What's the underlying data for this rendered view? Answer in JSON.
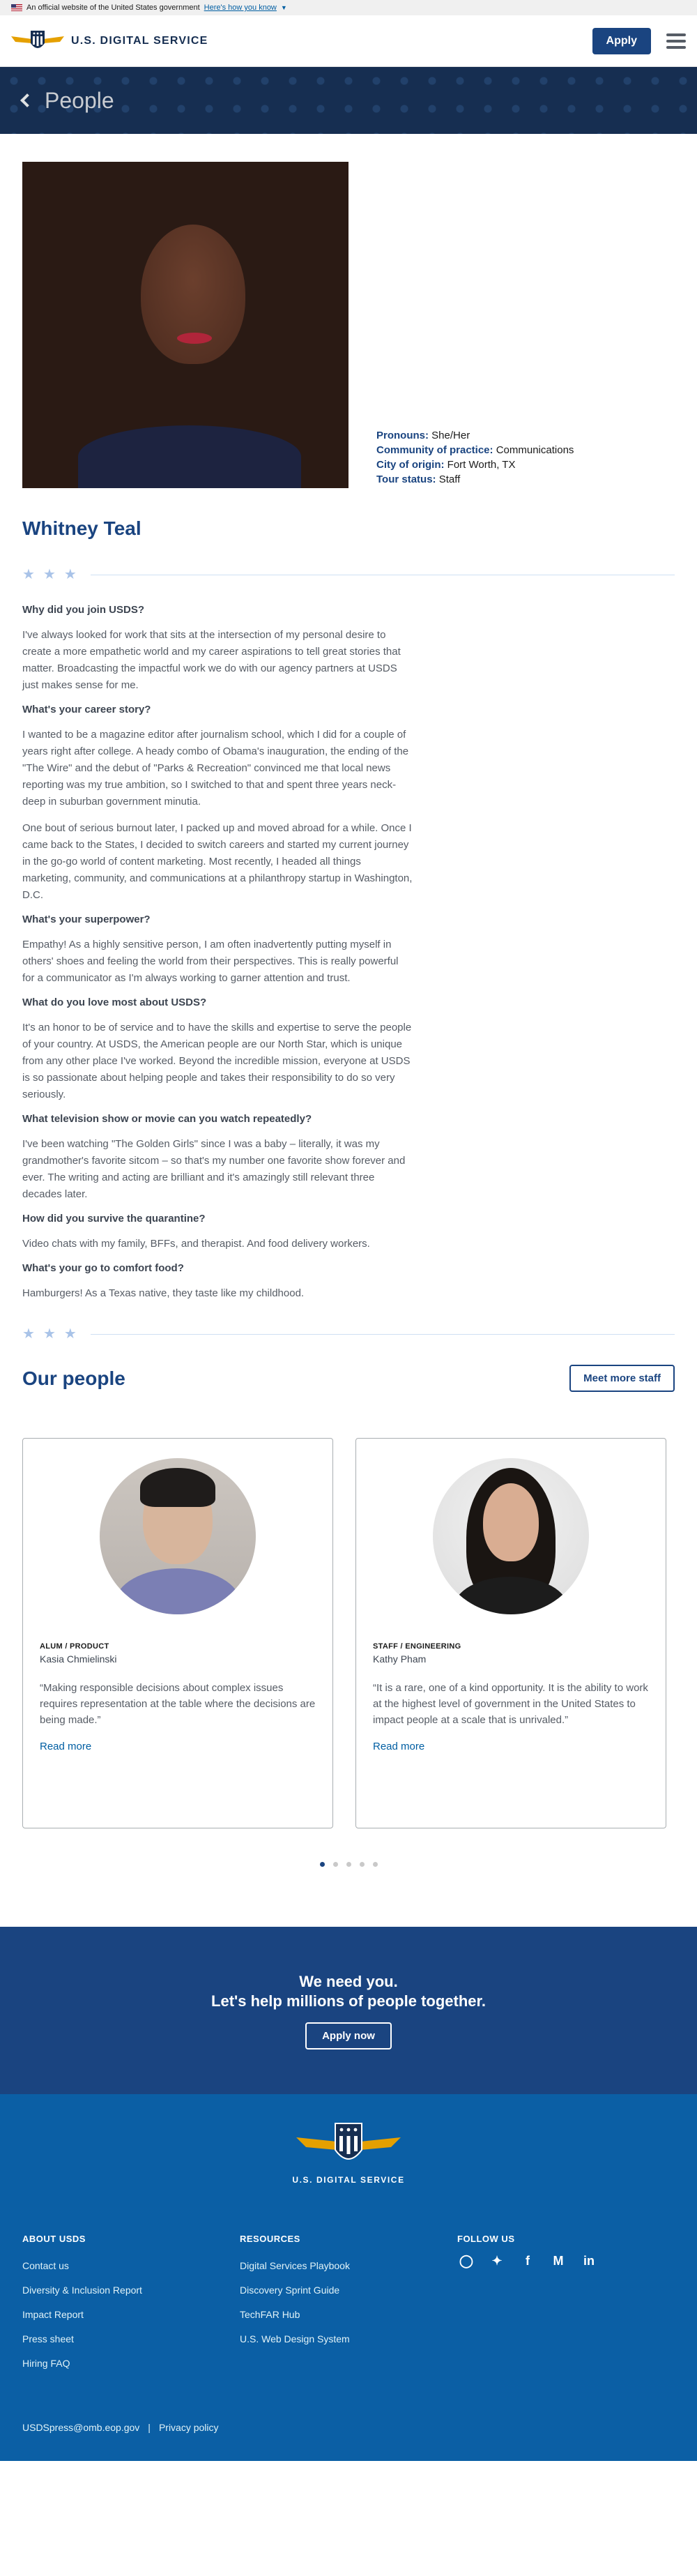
{
  "gov_banner": {
    "text": "An official website of the United States government",
    "link": "Here's how you know"
  },
  "header": {
    "logo_text": "U.S. DIGITAL SERVICE",
    "apply_label": "Apply"
  },
  "hero": {
    "title": "People"
  },
  "profile": {
    "facts": [
      {
        "label": "Pronouns:",
        "value": "She/Her"
      },
      {
        "label": "Community of practice:",
        "value": "Communications"
      },
      {
        "label": "City of origin:",
        "value": "Fort Worth, TX"
      },
      {
        "label": "Tour status:",
        "value": "Staff"
      }
    ],
    "name": "Whitney Teal",
    "qa": [
      {
        "q": "Why did you join USDS?",
        "a": [
          "I've always looked for work that sits at the intersection of my personal desire to create a more empathetic world and my career aspirations to tell great stories that matter. Broadcasting the impactful work we do with our agency partners at USDS just makes sense for me."
        ]
      },
      {
        "q": "What's your career story?",
        "a": [
          "I wanted to be a magazine editor after journalism school, which I did for a couple of years right after college. A heady combo of Obama's inauguration, the ending of the \"The Wire\" and the debut of \"Parks & Recreation\" convinced me that local news reporting was my true ambition, so I switched to that and spent three years neck-deep in suburban government minutia.",
          "One bout of serious burnout later, I packed up and moved abroad for a while. Once I came back to the States, I decided to switch careers and started my current journey in the go-go world of content marketing. Most recently, I headed all things marketing, community, and communications at a philanthropy startup in Washington, D.C."
        ]
      },
      {
        "q": "What's your superpower?",
        "a": [
          "Empathy! As a highly sensitive person, I am often inadvertently putting myself in others' shoes and feeling the world from their perspectives. This is really powerful for a communicator as I'm always working to garner attention and trust."
        ]
      },
      {
        "q": "What do you love most about USDS?",
        "a": [
          "It's an honor to be of service and to have the skills and expertise to serve the people of your country. At USDS, the American people are our North Star, which is unique from any other place I've worked. Beyond the incredible mission, everyone at USDS is so passionate about helping people and takes their responsibility to do so very seriously."
        ]
      },
      {
        "q": "What television show or movie can you watch repeatedly?",
        "a": [
          "I've been watching \"The Golden Girls\" since I was a baby – literally, it was my grandmother's favorite sitcom – so that's my number one favorite show forever and ever. The writing and acting are brilliant and it's amazingly still relevant three decades later."
        ]
      },
      {
        "q": "How did you survive the quarantine?",
        "a": [
          "Video chats with my family, BFFs, and therapist. And food delivery workers."
        ]
      },
      {
        "q": "What's your go to comfort food?",
        "a": [
          "Hamburgers! As a Texas native, they taste like my childhood."
        ]
      }
    ]
  },
  "our_people": {
    "title": "Our people",
    "meet_label": "Meet more staff",
    "cards": [
      {
        "role": "ALUM / PRODUCT",
        "name": "Kasia Chmielinski",
        "quote": "“Making responsible decisions about complex issues requires representation at the table where the decisions are being made.”",
        "link": "Read more"
      },
      {
        "role": "STAFF / ENGINEERING",
        "name": "Kathy Pham",
        "quote": "“It is a rare, one of a kind opportunity. It is the ability to work at the highest level of government in the United States to impact people at a scale that is unrivaled.”",
        "link": "Read more"
      }
    ]
  },
  "cta": {
    "line1": "We need you.",
    "line2": "Let's help millions of people together.",
    "button": "Apply now"
  },
  "footer": {
    "logo_text": "U.S. DIGITAL SERVICE",
    "about": {
      "heading": "ABOUT USDS",
      "links": [
        "Contact us",
        "Diversity & Inclusion Report",
        "Impact Report",
        "Press sheet",
        "Hiring FAQ"
      ]
    },
    "resources": {
      "heading": "RESOURCES",
      "links": [
        "Digital Services Playbook",
        "Discovery Sprint Guide",
        "TechFAR Hub",
        "U.S. Web Design System"
      ]
    },
    "follow": {
      "heading": "FOLLOW US",
      "icons": [
        "instagram-icon",
        "twitter-icon",
        "facebook-icon",
        "medium-icon",
        "linkedin-icon"
      ]
    },
    "email": "USDSpress@omb.eop.gov",
    "separator": "|",
    "privacy": "Privacy policy"
  }
}
